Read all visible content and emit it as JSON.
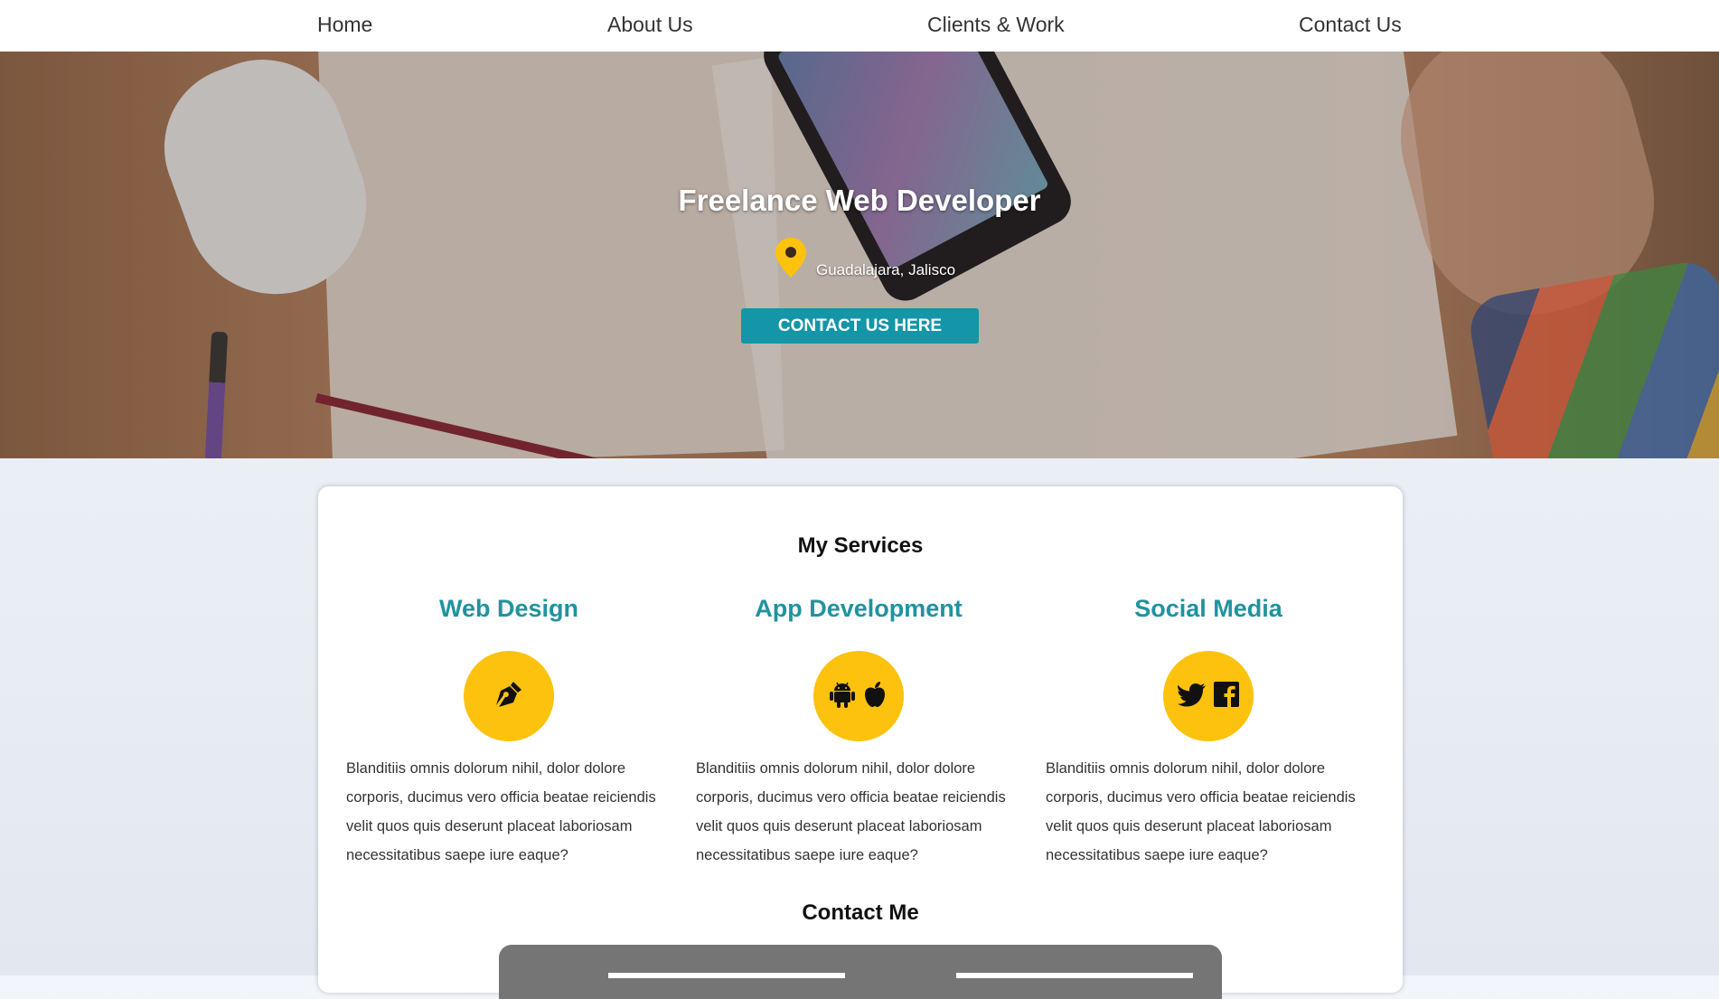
{
  "nav": {
    "items": [
      {
        "label": "Home"
      },
      {
        "label": "About Us"
      },
      {
        "label": "Clients & Work"
      },
      {
        "label": "Contact Us"
      }
    ]
  },
  "hero": {
    "title": "Freelance Web Developer",
    "location": "Guadalajara, Jalisco",
    "location_icon": "map-pin-icon",
    "cta_label": "CONTACT US HERE"
  },
  "services": {
    "title": "My Services",
    "items": [
      {
        "heading": "Web Design",
        "icons": [
          "pen-nib-icon"
        ],
        "text": "Blanditiis omnis dolorum nihil, dolor dolore corporis, ducimus vero officia beatae reiciendis velit quos quis deserunt placeat laboriosam necessitatibus saepe iure eaque?"
      },
      {
        "heading": "App Development",
        "icons": [
          "android-icon",
          "apple-icon"
        ],
        "text": "Blanditiis omnis dolorum nihil, dolor dolore corporis, ducimus vero officia beatae reiciendis velit quos quis deserunt placeat laboriosam necessitatibus saepe iure eaque?"
      },
      {
        "heading": "Social Media",
        "icons": [
          "twitter-icon",
          "facebook-icon"
        ],
        "text": "Blanditiis omnis dolorum nihil, dolor dolore corporis, ducimus vero officia beatae reiciendis velit quos quis deserunt placeat laboriosam necessitatibus saepe iure eaque?"
      }
    ]
  },
  "contact": {
    "title": "Contact Me"
  },
  "colors": {
    "accent_teal": "#1495a8",
    "service_heading": "#20939f",
    "icon_circle": "#fdc20e",
    "contact_box": "#757575"
  }
}
